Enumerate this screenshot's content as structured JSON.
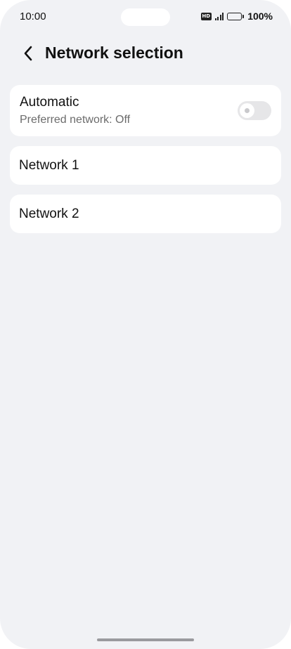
{
  "status_bar": {
    "time": "10:00",
    "hd_badge": "HD",
    "battery_percent": "100%",
    "icons": [
      "hd-icon",
      "signal-icon",
      "battery-icon"
    ]
  },
  "header": {
    "back_icon": "chevron-left-icon",
    "title": "Network selection"
  },
  "automatic": {
    "title": "Automatic",
    "subtitle": "Preferred network: Off",
    "toggle_on": false
  },
  "networks": [
    {
      "label": "Network 1"
    },
    {
      "label": "Network 2"
    }
  ],
  "colors": {
    "background": "#f1f2f5",
    "card": "#ffffff",
    "secondary_text": "#6b6b6b",
    "toggle_off_track": "#e6e6e8"
  }
}
